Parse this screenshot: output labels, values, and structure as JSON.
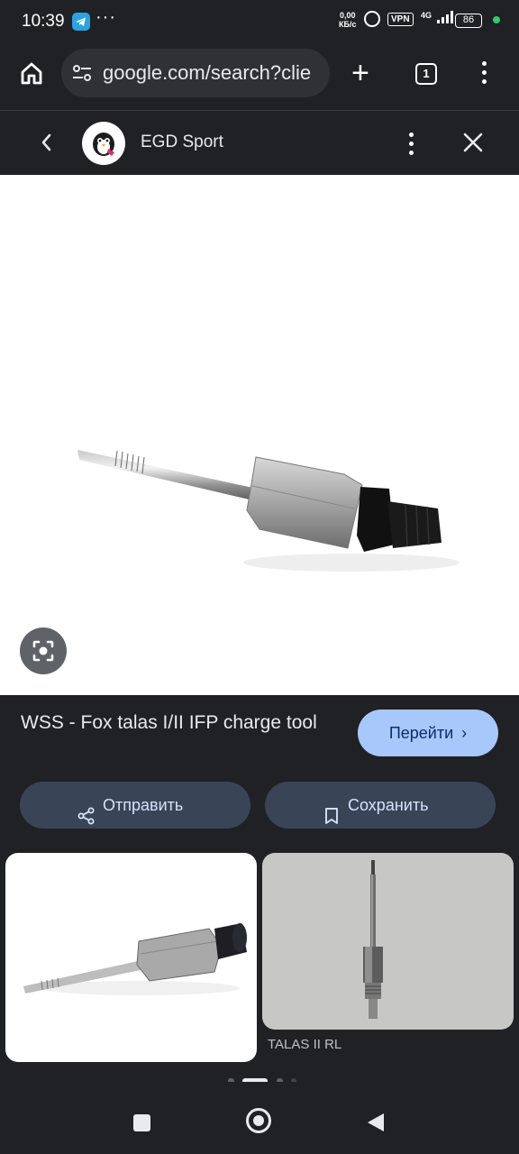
{
  "status_bar": {
    "time": "10:39",
    "speed_value": "0,00",
    "speed_unit": "КБ/с",
    "vpn": "VPN",
    "network": "4G",
    "battery": "86",
    "icons": [
      "telegram-icon",
      "more-notifications-icon",
      "alarm-icon",
      "signal-icon",
      "battery-icon"
    ]
  },
  "browser": {
    "url": "google.com/search?clie",
    "tab_count": "1"
  },
  "site_header": {
    "site_name": "EGD Sport"
  },
  "result": {
    "title": "WSS - Fox talas I/II IFP charge tool",
    "goto_label": "Перейти",
    "share_label": "Отправить",
    "save_label": "Сохранить"
  },
  "related": [
    {
      "caption": ""
    },
    {
      "caption": "TALAS II RL"
    }
  ],
  "pager": {
    "count": 4,
    "active": 1
  },
  "colors": {
    "background": "#202124",
    "goto_button": "#a8c7fa",
    "pill_button": "#394457"
  }
}
